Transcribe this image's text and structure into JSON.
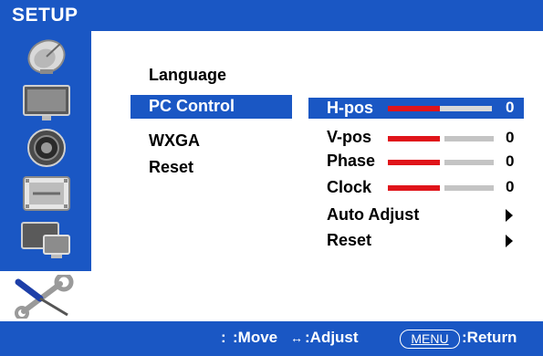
{
  "title": "SETUP",
  "sidebar": {
    "icons": [
      "satellite-dish-icon",
      "monitor-icon",
      "speaker-icon",
      "film-strip-icon",
      "pip-screen-icon",
      "tools-icon"
    ],
    "selected": "tools-icon"
  },
  "menu": {
    "items": [
      "Language",
      "PC Control",
      "WXGA",
      "Reset"
    ],
    "selected": "PC Control"
  },
  "submenu": {
    "sliders": [
      {
        "label": "H-pos",
        "value": "0",
        "fill": 0.5
      },
      {
        "label": "V-pos",
        "value": "0",
        "fill": 0.5
      },
      {
        "label": "Phase",
        "value": "0",
        "fill": 0.5
      },
      {
        "label": "Clock",
        "value": "0",
        "fill": 0.5
      }
    ],
    "actions": [
      "Auto Adjust",
      "Reset"
    ],
    "selected": "H-pos"
  },
  "hints": {
    "move": ":Move",
    "move_symbol": ":",
    "adjust": ":Adjust",
    "adjust_symbol": "↔",
    "menu_key": "MENU",
    "return": ":Return"
  },
  "colors": {
    "accent": "#1a57c4",
    "slider_fill": "#e0141a",
    "slider_track": "#c4c4c4",
    "text": "#000000",
    "selected_text": "#ffffff"
  }
}
